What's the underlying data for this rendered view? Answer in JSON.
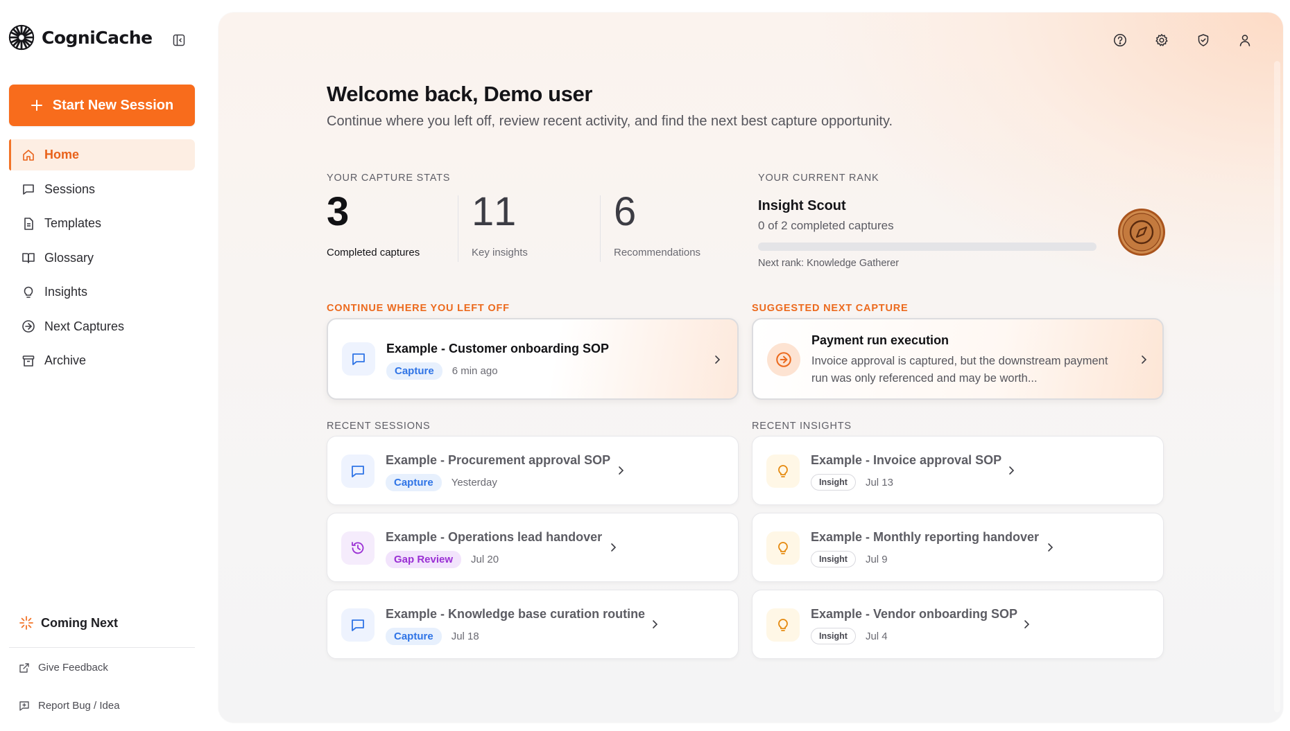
{
  "app": {
    "name": "CogniCache"
  },
  "sidebar": {
    "start_label": "Start New Session",
    "items": [
      {
        "label": "Home",
        "icon": "home-icon",
        "active": true
      },
      {
        "label": "Sessions",
        "icon": "message-square-icon",
        "active": false
      },
      {
        "label": "Templates",
        "icon": "file-text-icon",
        "active": false
      },
      {
        "label": "Glossary",
        "icon": "book-open-icon",
        "active": false
      },
      {
        "label": "Insights",
        "icon": "lightbulb-icon",
        "active": false
      },
      {
        "label": "Next Captures",
        "icon": "arrow-circle-icon",
        "active": false
      },
      {
        "label": "Archive",
        "icon": "archive-icon",
        "active": false
      }
    ],
    "coming_next": "Coming Next",
    "give_feedback": "Give Feedback",
    "report_bug": "Report Bug / Idea"
  },
  "header": {
    "icons": [
      "help-icon",
      "settings-icon",
      "shield-icon",
      "user-icon"
    ]
  },
  "welcome": {
    "title": "Welcome back, Demo user",
    "subtitle": "Continue where you left off, review recent activity, and find the next best capture opportunity."
  },
  "stats": {
    "label": "YOUR CAPTURE STATS",
    "completed": {
      "value": "3",
      "label": "Completed captures"
    },
    "insights": {
      "value": "11",
      "label": "Key insights"
    },
    "recommendations": {
      "value": "6",
      "label": "Recommendations"
    }
  },
  "rank": {
    "label": "YOUR CURRENT RANK",
    "title": "Insight Scout",
    "progress_text": "0 of 2 completed captures",
    "progress_fraction": 0,
    "next": "Next rank: Knowledge Gatherer"
  },
  "continue": {
    "label": "CONTINUE WHERE YOU LEFT OFF",
    "title": "Example - Customer onboarding SOP",
    "tag": "Capture",
    "time": "6 min ago"
  },
  "suggested": {
    "label": "SUGGESTED NEXT CAPTURE",
    "title": "Payment run execution",
    "desc": "Invoice approval is captured, but the downstream payment run was only referenced and may be worth..."
  },
  "recent_sessions": {
    "label": "RECENT SESSIONS",
    "items": [
      {
        "title": "Example - Procurement approval SOP",
        "tag": "Capture",
        "time": "Yesterday"
      },
      {
        "title": "Example - Operations lead handover",
        "tag": "Gap Review",
        "time": "Jul 20"
      },
      {
        "title": "Example - Knowledge base curation routine",
        "tag": "Capture",
        "time": "Jul 18"
      }
    ]
  },
  "recent_insights": {
    "label": "RECENT INSIGHTS",
    "items": [
      {
        "title": "Example - Invoice approval SOP",
        "tag": "Insight",
        "time": "Jul 13"
      },
      {
        "title": "Example - Monthly reporting handover",
        "tag": "Insight",
        "time": "Jul 9"
      },
      {
        "title": "Example - Vendor onboarding SOP",
        "tag": "Insight",
        "time": "Jul 4"
      }
    ]
  },
  "colors": {
    "accent": "#f86c1c",
    "capture_tag": "#2f74e6",
    "gap_tag": "#9a2fd4",
    "badge": "#c97a3c"
  }
}
